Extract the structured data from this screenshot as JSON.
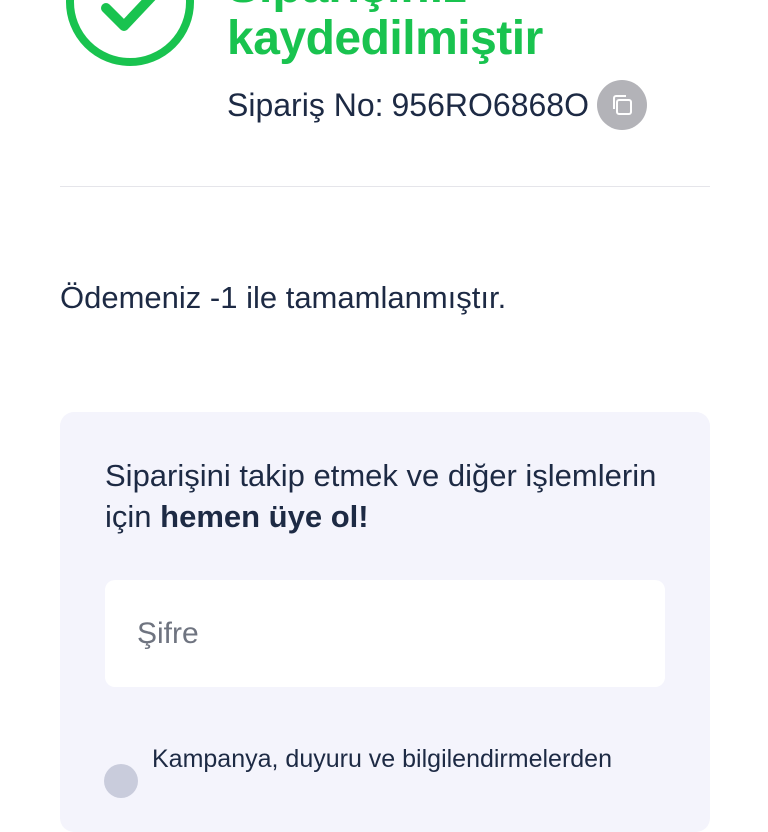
{
  "success": {
    "title_line1": "Siparişiniz",
    "title_line2": "kaydedilmiştir",
    "order_label": "Sipariş No:",
    "order_number": "956RO6868O",
    "copy_icon": "copy-icon",
    "accent_color": "#19c34f"
  },
  "payment": {
    "message": "Ödemeniz -1 ile tamamlanmıştır."
  },
  "signup": {
    "text_prefix": "Siparişini takip etmek ve diğer işlemlerin için ",
    "text_bold": "hemen üye ol!",
    "password_placeholder": "Şifre",
    "consent_text": "Kampanya, duyuru ve bilgilendirmelerden"
  }
}
